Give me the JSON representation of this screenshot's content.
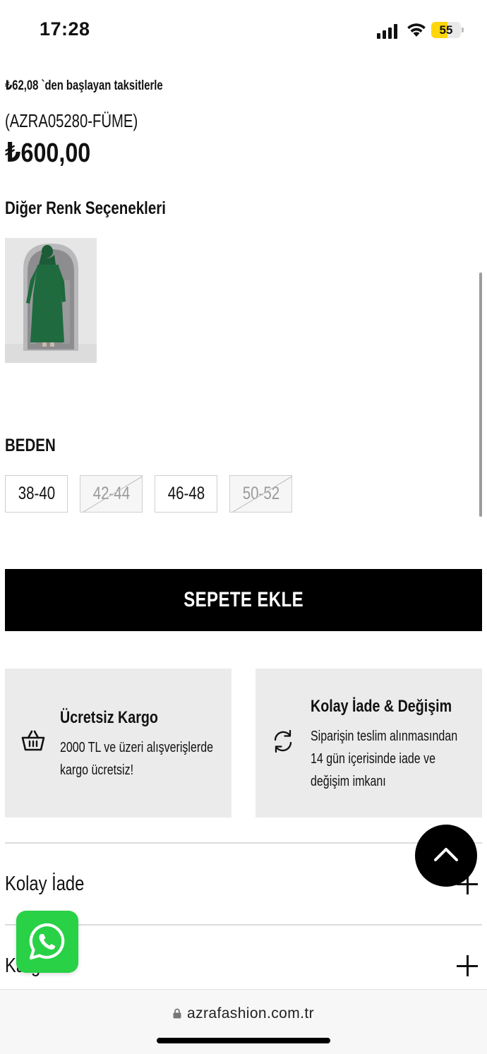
{
  "status_bar": {
    "time": "17:28",
    "battery": "55",
    "battery_level": 0.55,
    "battery_color": "#ffd60a"
  },
  "product": {
    "installment": "₺62,08 `den başlayan taksitlerle",
    "sku": "(AZRA05280-FÜME)",
    "price": "₺600,00"
  },
  "colors": {
    "title": "Diğer Renk Seçenekleri",
    "options": [
      {
        "name": "green-dress-thumbnail",
        "swatch": "#1f6b3f"
      }
    ]
  },
  "sizes": {
    "title": "BEDEN",
    "options": [
      {
        "label": "38-40",
        "available": true
      },
      {
        "label": "42-44",
        "available": false
      },
      {
        "label": "46-48",
        "available": true
      },
      {
        "label": "50-52",
        "available": false
      }
    ]
  },
  "add_to_cart": {
    "label": "SEPETE EKLE"
  },
  "info_cards": [
    {
      "icon": "basket-icon",
      "title": "Ücretsiz Kargo",
      "description": [
        "2000 TL ve üzeri alışverişlerde",
        "kargo ücretsiz!"
      ]
    },
    {
      "icon": "refresh-icon",
      "title": "Kolay İade & Değişim",
      "description": [
        "Siparişin teslim alınmasından",
        "14 gün içerisinde iade ve",
        "değişim imkanı"
      ]
    }
  ],
  "accordions": [
    {
      "label": "Kolay İade",
      "icon": "plus-icon"
    },
    {
      "label": "Kargo",
      "icon": "plus-icon"
    }
  ],
  "floating": {
    "scroll_top_icon": "chevron-up-icon",
    "whatsapp_icon": "whatsapp-icon",
    "whatsapp_color": "#28d146"
  },
  "browser": {
    "url": "azrafashion.com.tr"
  }
}
